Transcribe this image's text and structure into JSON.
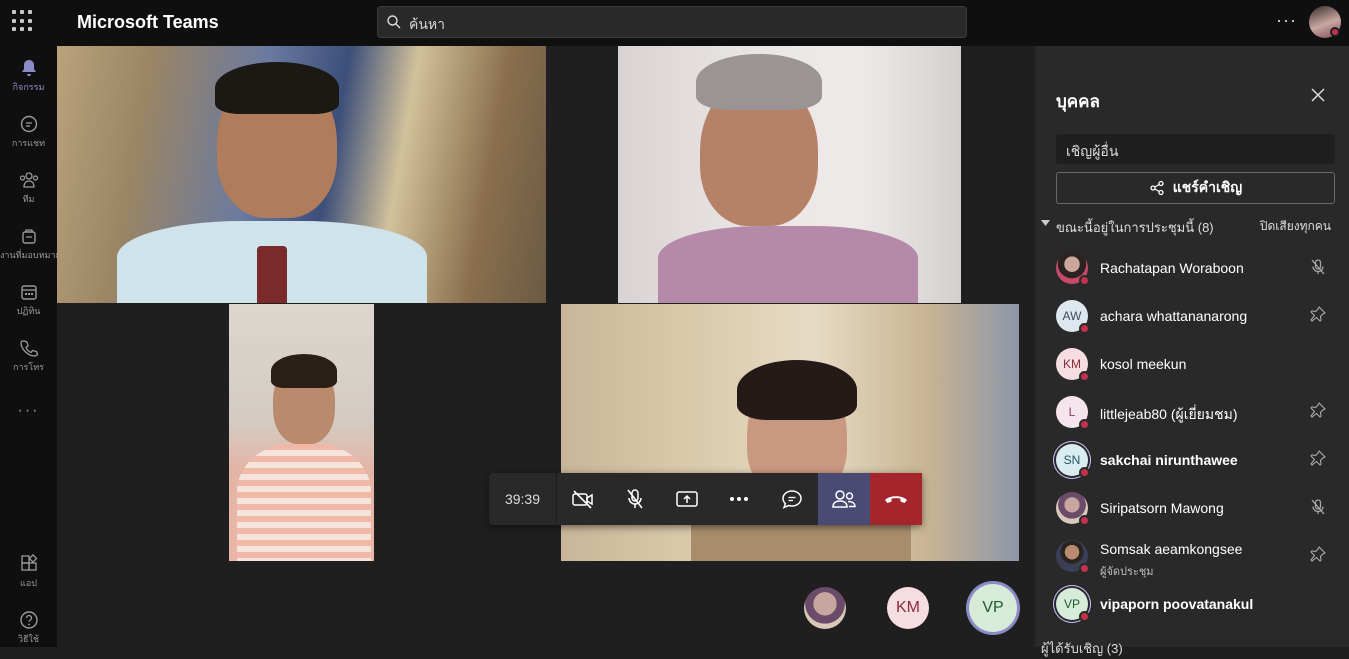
{
  "app": {
    "title": "Microsoft Teams"
  },
  "search": {
    "placeholder": "ค้นหา"
  },
  "rail": [
    {
      "label": "กิจกรรม",
      "icon": "bell-icon"
    },
    {
      "label": "การแชท",
      "icon": "chat-icon"
    },
    {
      "label": "ทีม",
      "icon": "teams-icon"
    },
    {
      "label": "งานที่มอบหมาย",
      "icon": "assignments-icon"
    },
    {
      "label": "ปฏิทิน",
      "icon": "calendar-icon"
    },
    {
      "label": "การโทร",
      "icon": "phone-icon"
    },
    {
      "label": "แอป",
      "icon": "apps-icon"
    },
    {
      "label": "วิธีใช้",
      "icon": "help-icon"
    }
  ],
  "call": {
    "timer": "39:39",
    "controls": [
      "camera-off-icon",
      "mic-off-icon",
      "share-screen-icon",
      "more-icon",
      "chat-icon",
      "participants-icon",
      "hang-up-icon"
    ]
  },
  "strip": {
    "km": "KM",
    "vp": "VP"
  },
  "panel": {
    "title": "บุคคล",
    "invite_placeholder": "เชิญผู้อื่น",
    "share_label": "แชร์คำเชิญ",
    "section_label": "ขณะนี้อยู่ในการประชุมนี้ (8)",
    "mute_all": "ปิดเสียงทุกคน",
    "section2_label": "ผู้ได้รับเชิญ (3)",
    "participants": [
      {
        "name": "Rachatapan Woraboon",
        "initials": "",
        "role": "",
        "action_icon": "mic-off-icon",
        "bold": false
      },
      {
        "name": "achara whattananarong",
        "initials": "AW",
        "role": "",
        "action_icon": "pin-icon",
        "bold": false
      },
      {
        "name": "kosol meekun",
        "initials": "KM",
        "role": "",
        "action_icon": "",
        "bold": false
      },
      {
        "name": "littlejeab80 (ผู้เยี่ยมชม)",
        "initials": "L",
        "role": "",
        "action_icon": "pin-icon",
        "bold": false
      },
      {
        "name": "sakchai nirunthawee",
        "initials": "SN",
        "role": "",
        "action_icon": "pin-icon",
        "bold": true
      },
      {
        "name": "Siripatsorn Mawong",
        "initials": "",
        "role": "",
        "action_icon": "mic-off-icon",
        "bold": false
      },
      {
        "name": "Somsak aeamkongsee",
        "initials": "",
        "role": "ผู้จัดประชุม",
        "action_icon": "pin-icon",
        "bold": false
      },
      {
        "name": "vipaporn poovatanakul",
        "initials": "VP",
        "role": "",
        "action_icon": "",
        "bold": true
      }
    ]
  },
  "colors": {
    "accent": "#4a4b73",
    "leave": "#a4262c",
    "status_busy": "#c4314b"
  }
}
